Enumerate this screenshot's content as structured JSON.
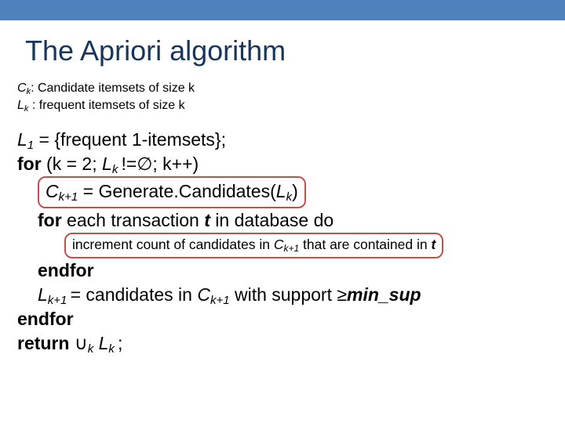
{
  "title": "The Apriori algorithm",
  "defs": {
    "ck_sym": "C",
    "ck_sub": "k",
    "ck_text": ": Candidate itemsets of size k",
    "lk_sym": "L",
    "lk_sub": "k",
    "lk_text": " : frequent itemsets of size k"
  },
  "algo": {
    "l1_a": "L",
    "l1_sub": "1",
    "l1_b": " = {frequent 1-itemsets};",
    "for_kw": "for",
    "for_paren_a": " (k = 2; ",
    "for_L": "L",
    "for_L_sub": "k ",
    "for_ne": "!=",
    "for_empty": "∅",
    "for_rest": "; k++)",
    "gen_C": "C",
    "gen_C_sub": "k+1",
    "gen_eq": " = Generate",
    "gen_dot": ".",
    "gen_cand": "Candidates(",
    "gen_L": "L",
    "gen_L_sub": "k",
    "gen_close": ")",
    "foreach_kw": "for",
    "foreach_txt": " each transaction ",
    "foreach_t": "t",
    "foreach_in": " in database do",
    "inc_a": "increment count of candidates in ",
    "inc_C": "C",
    "inc_C_sub": "k+1",
    "inc_b": " that are contained in ",
    "inc_t": "t",
    "endfor1": "endfor",
    "lk1_L": "L",
    "lk1_sub": "k+1 ",
    "lk1_eq": " = candidates in ",
    "lk1_C": "C",
    "lk1_Csub": "k+1",
    "lk1_with": " with support ",
    "lk1_ge": "≥",
    "lk1_min": "min_sup",
    "endfor2": "endfor",
    "return_kw": "return",
    "return_cup": " ∪",
    "return_sub": "k",
    "return_sp": " ",
    "return_L": "L",
    "return_Lsub": "k ",
    "return_semi": ";"
  }
}
